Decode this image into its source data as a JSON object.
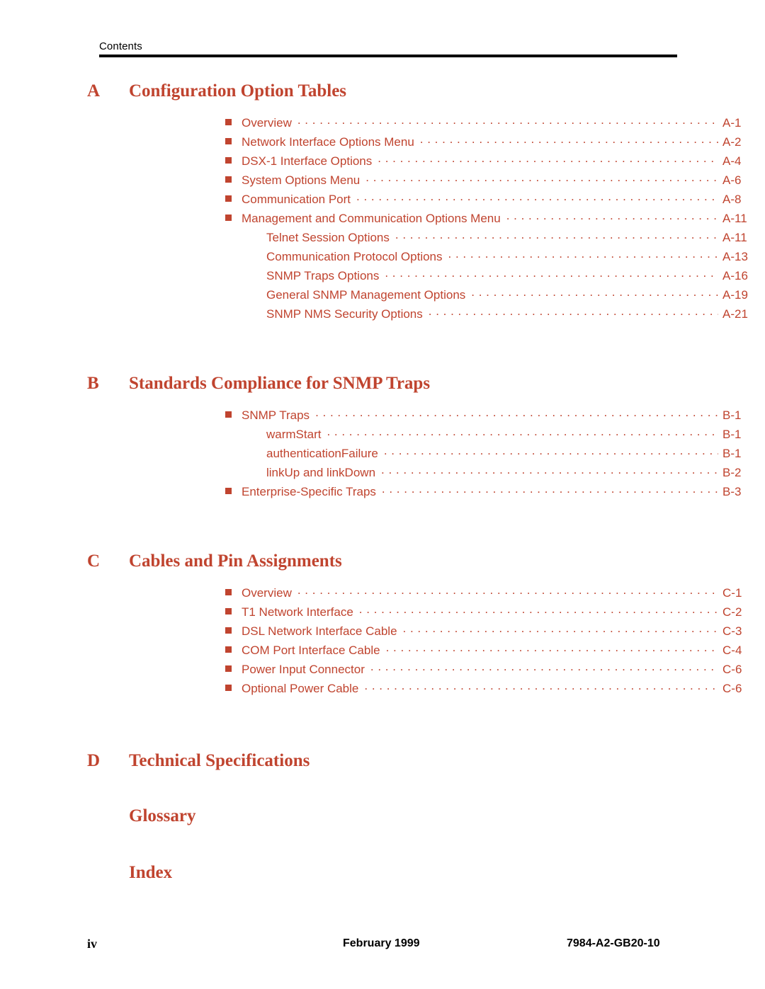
{
  "header": {
    "running_head": "Contents"
  },
  "colors": {
    "accent_red": "#C0442F",
    "text_black": "#000000",
    "page_background": "#FFFFFF"
  },
  "sections": [
    {
      "letter": "A",
      "title": "Configuration Option Tables",
      "entries": [
        {
          "level": 1,
          "label": "Overview",
          "page": "A-1"
        },
        {
          "level": 1,
          "label": "Network Interface Options Menu",
          "page": "A-2"
        },
        {
          "level": 1,
          "label": "DSX-1 Interface Options",
          "page": "A-4"
        },
        {
          "level": 1,
          "label": "System Options Menu",
          "page": "A-6"
        },
        {
          "level": 1,
          "label": "Communication Port",
          "page": "A-8"
        },
        {
          "level": 1,
          "label": "Management and Communication Options Menu",
          "page": "A-11"
        },
        {
          "level": 2,
          "label": "Telnet Session Options",
          "page": "A-11"
        },
        {
          "level": 2,
          "label": "Communication Protocol Options",
          "page": "A-13"
        },
        {
          "level": 2,
          "label": "SNMP Traps Options",
          "page": "A-16"
        },
        {
          "level": 2,
          "label": "General SNMP Management Options",
          "page": "A-19"
        },
        {
          "level": 2,
          "label": "SNMP NMS Security Options",
          "page": "A-21"
        }
      ]
    },
    {
      "letter": "B",
      "title": "Standards Compliance for SNMP Traps",
      "entries": [
        {
          "level": 1,
          "label": "SNMP Traps",
          "page": "B-1"
        },
        {
          "level": 2,
          "label": "warmStart",
          "page": "B-1"
        },
        {
          "level": 2,
          "label": "authenticationFailure",
          "page": "B-1"
        },
        {
          "level": 2,
          "label": "linkUp and linkDown",
          "page": "B-2"
        },
        {
          "level": 1,
          "label": "Enterprise-Specific Traps",
          "page": "B-3"
        }
      ]
    },
    {
      "letter": "C",
      "title": "Cables and Pin Assignments",
      "entries": [
        {
          "level": 1,
          "label": "Overview",
          "page": "C-1"
        },
        {
          "level": 1,
          "label": "T1 Network Interface",
          "page": "C-2"
        },
        {
          "level": 1,
          "label": "DSL Network Interface Cable",
          "page": "C-3"
        },
        {
          "level": 1,
          "label": "COM Port Interface Cable",
          "page": "C-4"
        },
        {
          "level": 1,
          "label": "Power Input Connector",
          "page": "C-6"
        },
        {
          "level": 1,
          "label": "Optional Power Cable",
          "page": "C-6"
        }
      ]
    },
    {
      "letter": "D",
      "title": "Technical Specifications",
      "entries": []
    },
    {
      "letter": "",
      "title": "Glossary",
      "entries": []
    },
    {
      "letter": "",
      "title": "Index",
      "entries": []
    }
  ],
  "footer": {
    "page_number": "iv",
    "date": "February 1999",
    "document_number": "7984-A2-GB20-10"
  }
}
